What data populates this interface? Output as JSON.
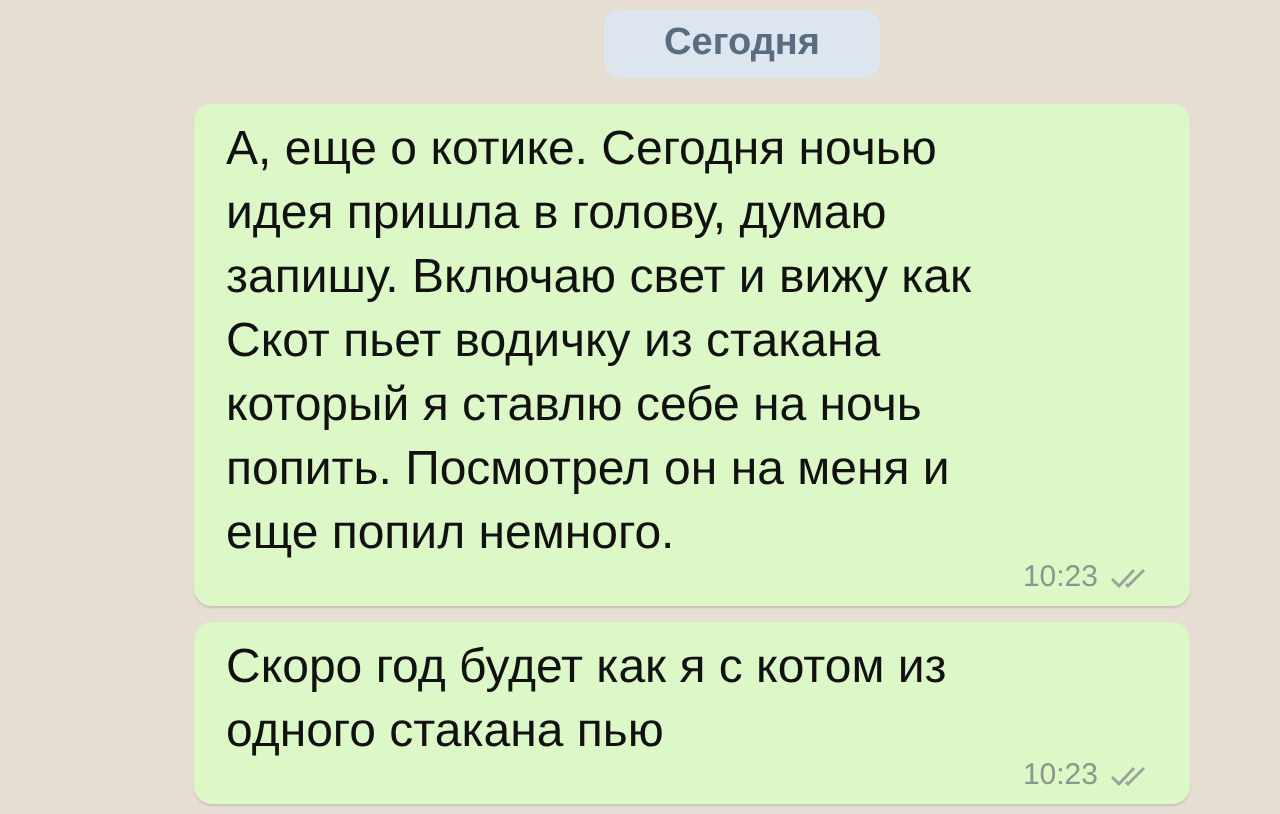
{
  "date_pill": {
    "label": "Сегодня"
  },
  "messages": [
    {
      "text": "А, еще о котике. Сегодня ночью\nидея пришла в голову, думаю\nзапишу. Включаю свет и вижу как\nСкот пьет водичку из стакана\nкоторый я ставлю себе на ночь\nпопить. Посмотрел он на меня и\nеще попил немного.",
      "time": "10:23",
      "read": false
    },
    {
      "text": "Скоро год будет как я с котом из\nодного стакана пью",
      "time": "10:23",
      "read": false
    }
  ]
}
